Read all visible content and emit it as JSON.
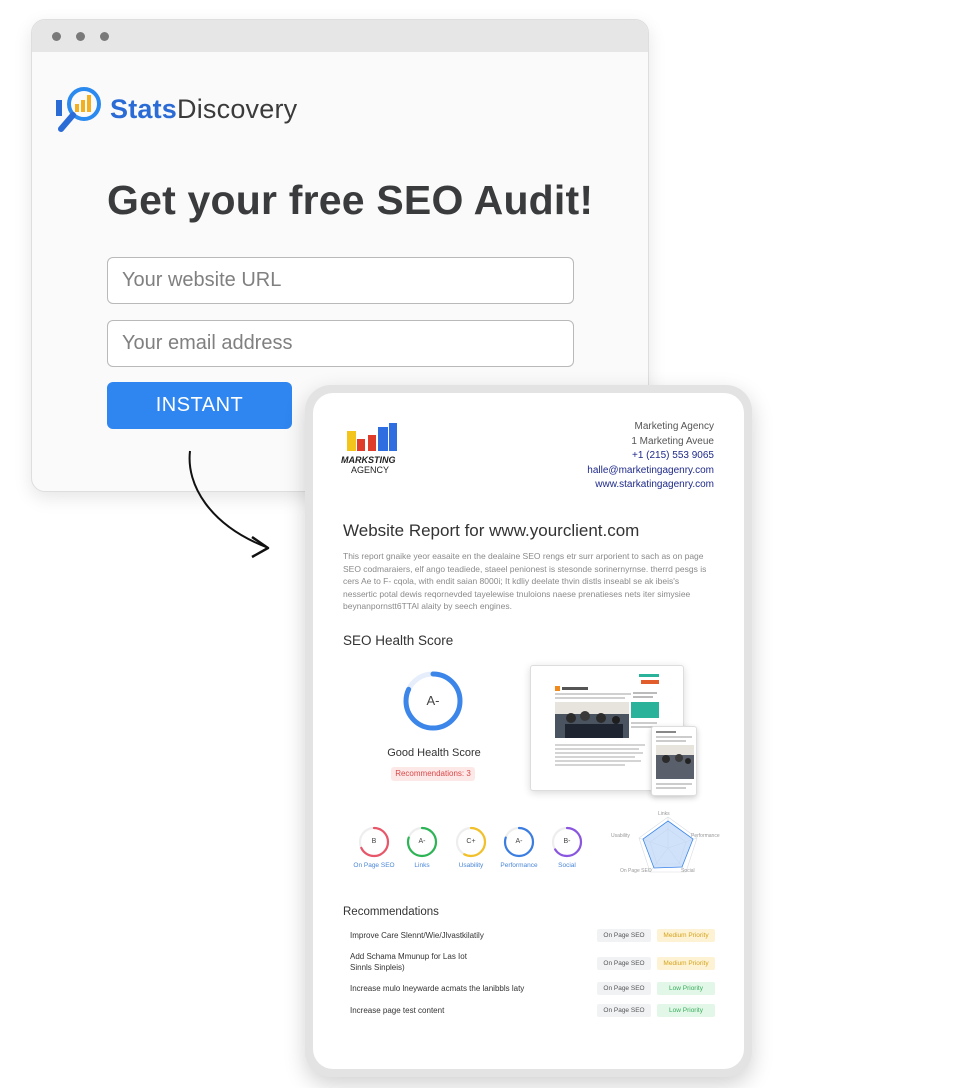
{
  "brand": {
    "stats": "Stats",
    "discovery": "Discovery"
  },
  "form": {
    "headline": "Get your free SEO Audit!",
    "url_placeholder": "Your website URL",
    "email_placeholder": "Your email address",
    "button_label": "INSTANT"
  },
  "agency": {
    "logo_line1": "MARKSTING",
    "logo_line2": "AGENCY",
    "name": "Marketing Agency",
    "address": "1 Marketing Aveue",
    "phone": "+1 (215) 553 9065",
    "email": "halle@marketingagenry.com",
    "website": "www.starkatingagenry.com"
  },
  "report": {
    "title": "Website Report for www.yourclient.com",
    "description": "This report gnaike yeor easaite en the dealaine SEO rengs etr surr arporient to sach as on page SEO codmaraiers, elf ango teadiede, staeel penionest is stesonde sorinernyrnse. therrd pesgs is cers Ae to F- cqola, with endit saian 8000i; It kdliy deelate thvin distls inseabl se ak ibeis's nessertic potal dewis reqornevded tayelewise tnuloions naese prenatieses nets iter simysiee beynanpornstt6TTAl alaity by seech engines.",
    "health_title": "SEO Health Score",
    "grade": "A-",
    "score_label": "Good Health Score",
    "recs_badge": "Recommendations: 3",
    "recs_title": "Recommendations"
  },
  "categories": [
    {
      "grade": "B",
      "label": "On Page SEO",
      "color": "#e8566a",
      "score": 0.68
    },
    {
      "grade": "A-",
      "label": "Links",
      "color": "#2cb455",
      "score": 0.8
    },
    {
      "grade": "C+",
      "label": "Usability",
      "color": "#f2c027",
      "score": 0.58
    },
    {
      "grade": "A-",
      "label": "Performance",
      "color": "#3b7de0",
      "score": 0.8
    },
    {
      "grade": "B-",
      "label": "Social",
      "color": "#8a56e0",
      "score": 0.66
    }
  ],
  "radar_labels": [
    "Links",
    "Performance",
    "Social",
    "On Page SEO",
    "Usability"
  ],
  "recommendations": [
    {
      "text": "Improve Care Slennt/Wie/Jlvastkilatily",
      "category": "On Page SEO",
      "priority": "Medium Priority"
    },
    {
      "text": "Add Schama Mmunup for Las Iot Sinnls Sinpleis)",
      "category": "On Page SEO",
      "priority": "Medium Priority"
    },
    {
      "text": "Increase mulo lneywarde acmats the lanibbls laty",
      "category": "On Page SEO",
      "priority": "Low Priority"
    },
    {
      "text": "Increase page test content",
      "category": "On Page SEO",
      "priority": "Low Priority"
    }
  ]
}
